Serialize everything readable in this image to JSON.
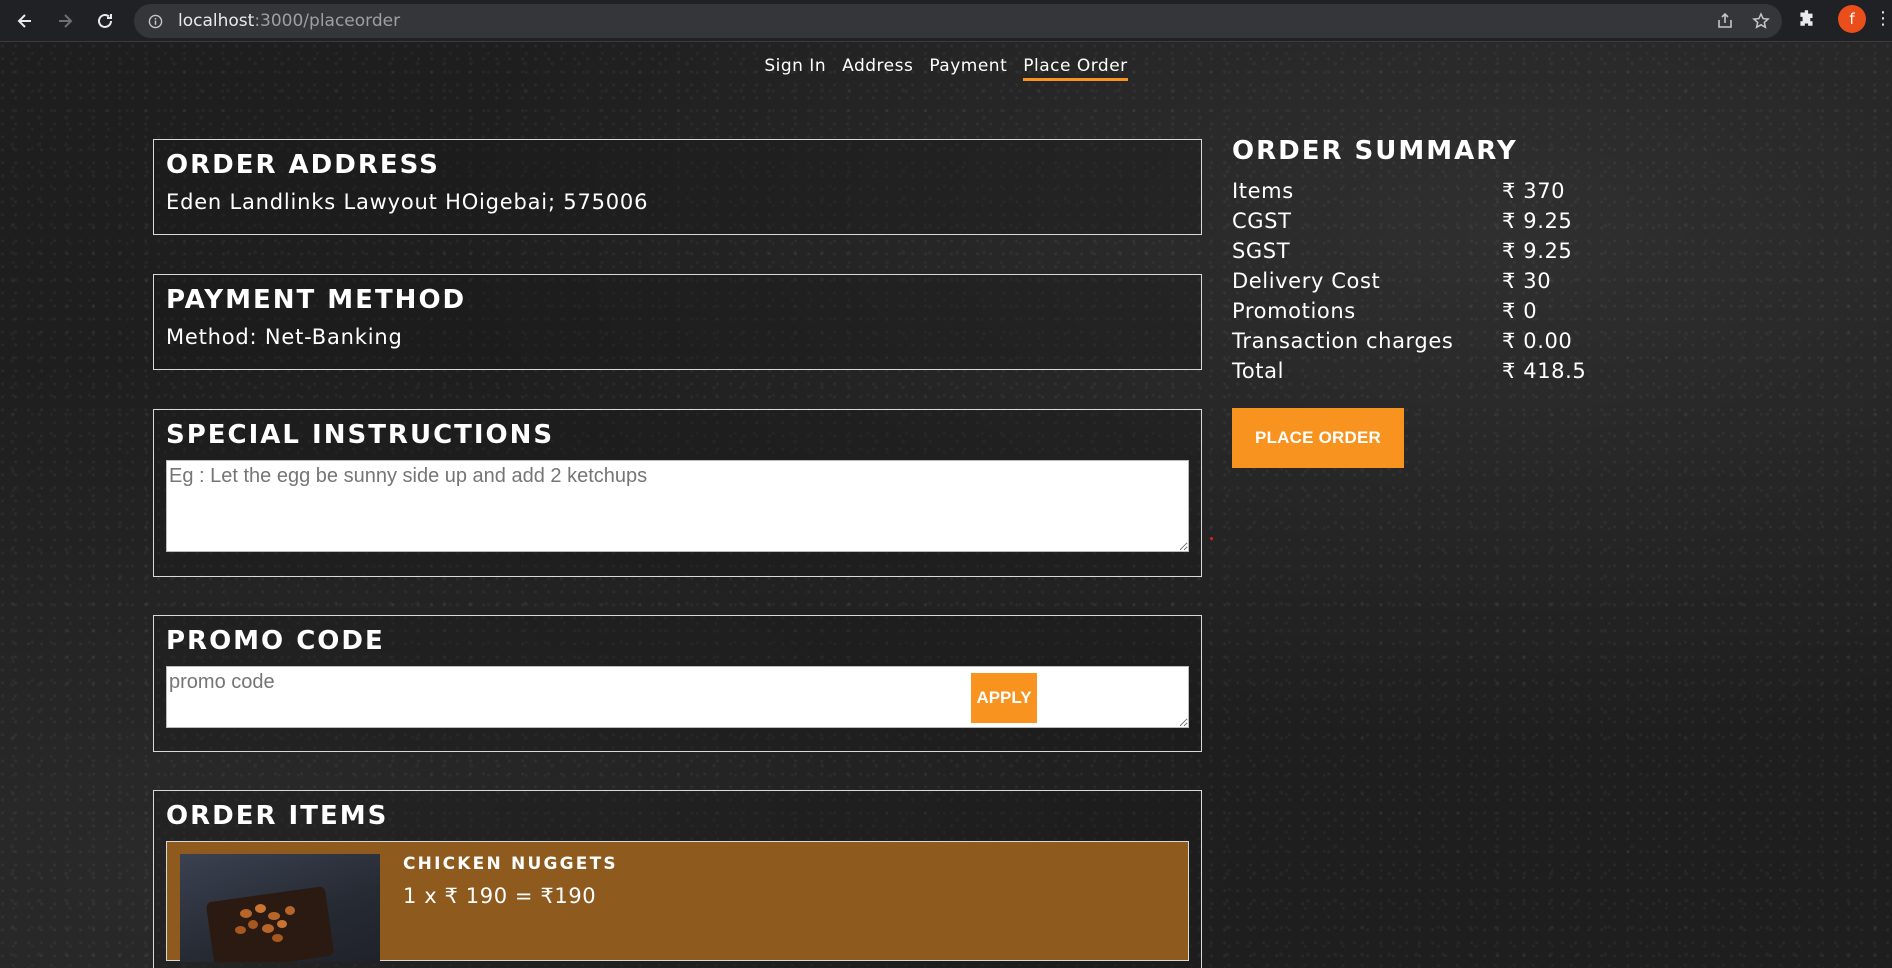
{
  "browser": {
    "url_host": "localhost",
    "url_path": ":3000/placeorder",
    "avatar_letter": "f",
    "icons": [
      "back-icon",
      "forward-icon",
      "reload-icon",
      "site-info-icon",
      "share-icon",
      "star-icon",
      "extensions-icon",
      "menu-icon"
    ]
  },
  "steps": [
    {
      "label": "Sign In",
      "active": false
    },
    {
      "label": "Address",
      "active": false
    },
    {
      "label": "Payment",
      "active": false
    },
    {
      "label": "Place Order",
      "active": true
    }
  ],
  "address": {
    "title": "ORDER ADDRESS",
    "text": "Eden Landlinks Lawyout HOigebai; 575006"
  },
  "payment": {
    "title": "PAYMENT METHOD",
    "text": "Method: Net-Banking"
  },
  "instructions": {
    "title": "SPECIAL INSTRUCTIONS",
    "placeholder": "Eg : Let the egg be sunny side up and add 2 ketchups"
  },
  "promo": {
    "title": "PROMO CODE",
    "placeholder": "promo code",
    "apply_label": "APPLY"
  },
  "order_items": {
    "title": "ORDER ITEMS",
    "items": [
      {
        "name": "CHICKEN NUGGETS",
        "price_line": "1 x ₹ 190 = ₹190"
      }
    ]
  },
  "summary": {
    "title": "ORDER SUMMARY",
    "rows": [
      {
        "label": "Items",
        "value": "₹ 370"
      },
      {
        "label": "CGST",
        "value": "₹ 9.25"
      },
      {
        "label": "SGST",
        "value": "₹ 9.25"
      },
      {
        "label": "Delivery Cost",
        "value": "₹ 30"
      },
      {
        "label": "Promotions",
        "value": "₹ 0"
      },
      {
        "label": "Transaction charges",
        "value": "₹ 0.00"
      },
      {
        "label": "Total",
        "value": "₹ 418.5"
      }
    ],
    "button_label": "PLACE ORDER"
  },
  "colors": {
    "accent": "#f7931e",
    "item_card": "#8e5a1e",
    "background": "#1e1e1e"
  }
}
